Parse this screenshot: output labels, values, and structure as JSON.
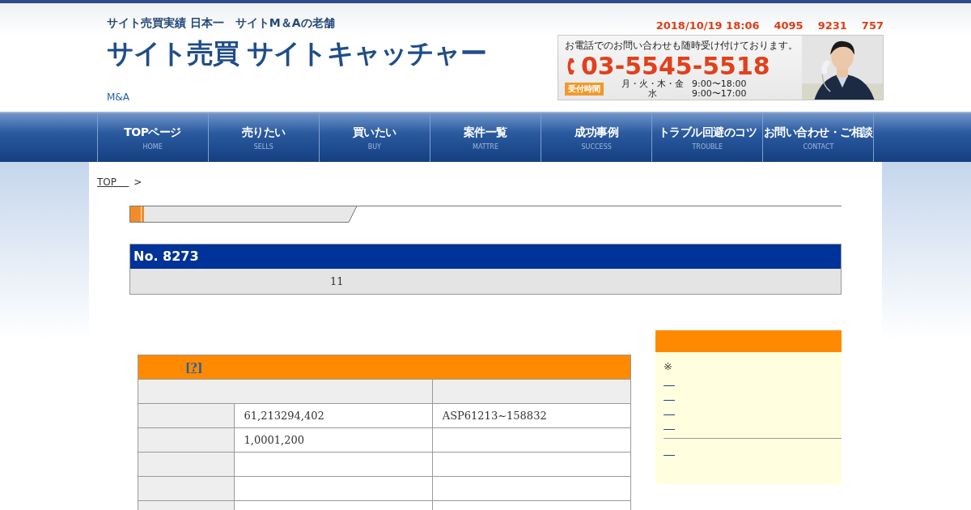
{
  "header": {
    "tagline": "サイト売買実績 日本一　サイトM＆Aの老舗",
    "logo": "サイト売買 サイトキャッチャー",
    "sub": "M&A",
    "stats": [
      "2018/10/19 18:06",
      "4095",
      "9231",
      "757"
    ],
    "phone_banner": {
      "note": "お電話でのお問い合わせも随時受け付けております。",
      "number": "03-5545-5518",
      "hours_badge": "受付時間",
      "hours": [
        {
          "days": "月・火・木・金",
          "time": "9:00〜18:00"
        },
        {
          "days": "水",
          "time": "9:00〜17:00"
        }
      ]
    }
  },
  "nav": [
    {
      "label": "TOPページ",
      "sub": "HOME"
    },
    {
      "label": "売りたい",
      "sub": "SELLS"
    },
    {
      "label": "買いたい",
      "sub": "BUY"
    },
    {
      "label": "案件一覧",
      "sub": "MATTRE"
    },
    {
      "label": "成功事例",
      "sub": "SUCCESS"
    },
    {
      "label": "トラブル回避のコツ",
      "sub": "TROUBLE"
    },
    {
      "label": "お問い合わせ・ご相談",
      "sub": "CONTACT"
    }
  ],
  "breadcrumb": {
    "link": "TOP",
    "separator": ">"
  },
  "listing": {
    "number": "No. 8273",
    "info": "11"
  },
  "table": {
    "help_link": "[?]",
    "rows": [
      {
        "value": "61,213294,402",
        "note": "ASP61213~158832"
      },
      {
        "value": "1,0001,200"
      }
    ]
  },
  "sidebar": {
    "note": "※"
  }
}
